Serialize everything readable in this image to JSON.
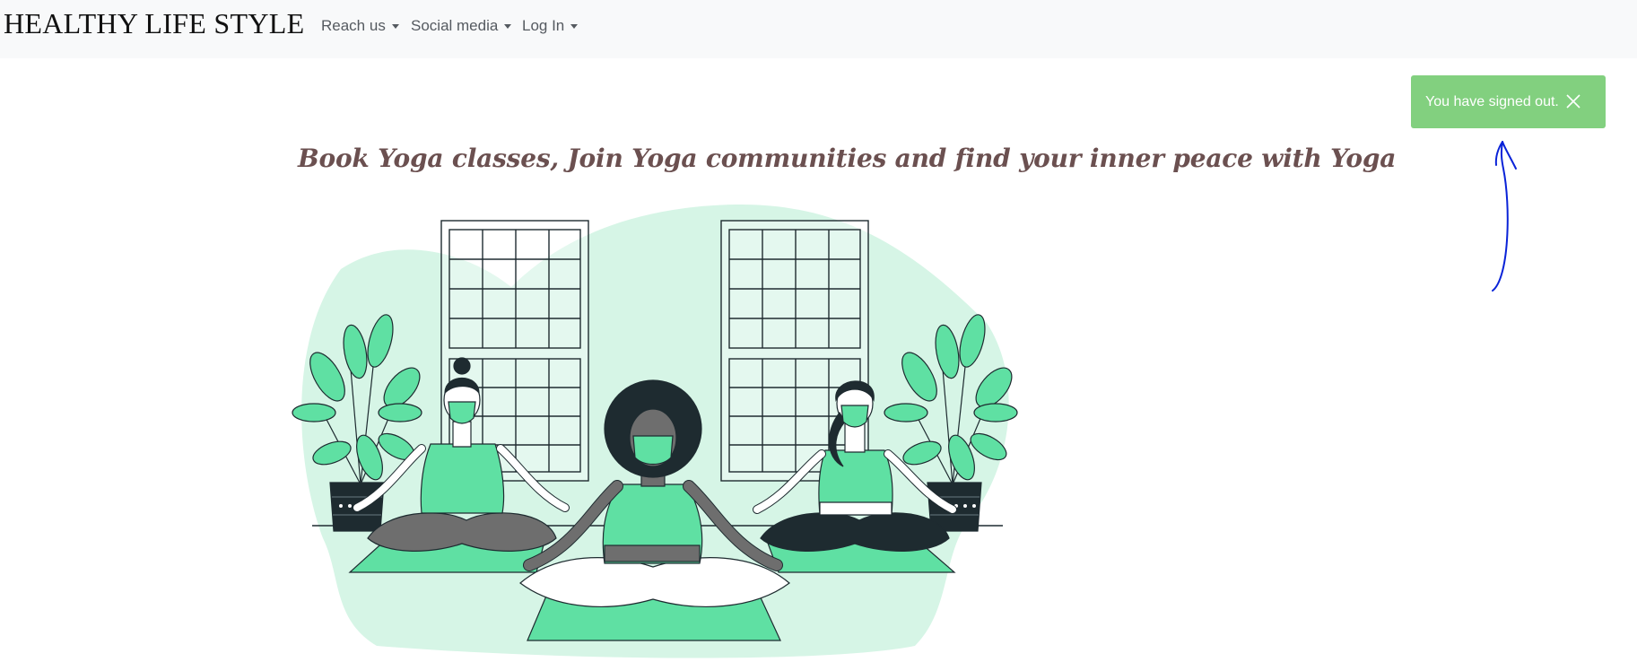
{
  "navbar": {
    "brand": "HEALTHY LIFE STYLE",
    "items": [
      {
        "label": "Reach us"
      },
      {
        "label": "Social media"
      },
      {
        "label": "Log In"
      }
    ]
  },
  "toast": {
    "message": "You have signed out.",
    "background": "#82d07f",
    "close_icon": "close-icon"
  },
  "hero": {
    "headline": "Book Yoga classes, Join Yoga communities and find your inner peace with Yoga",
    "illustration_icon": "yoga-class-illustration"
  },
  "annotation": {
    "arrow_icon": "hand-drawn-arrow-icon",
    "color": "#0a23d8"
  },
  "colors": {
    "accent_green": "#5fe0a3",
    "blob_mint": "#d6f5e6",
    "dark": "#1e2b30",
    "headline": "#6b5050"
  }
}
